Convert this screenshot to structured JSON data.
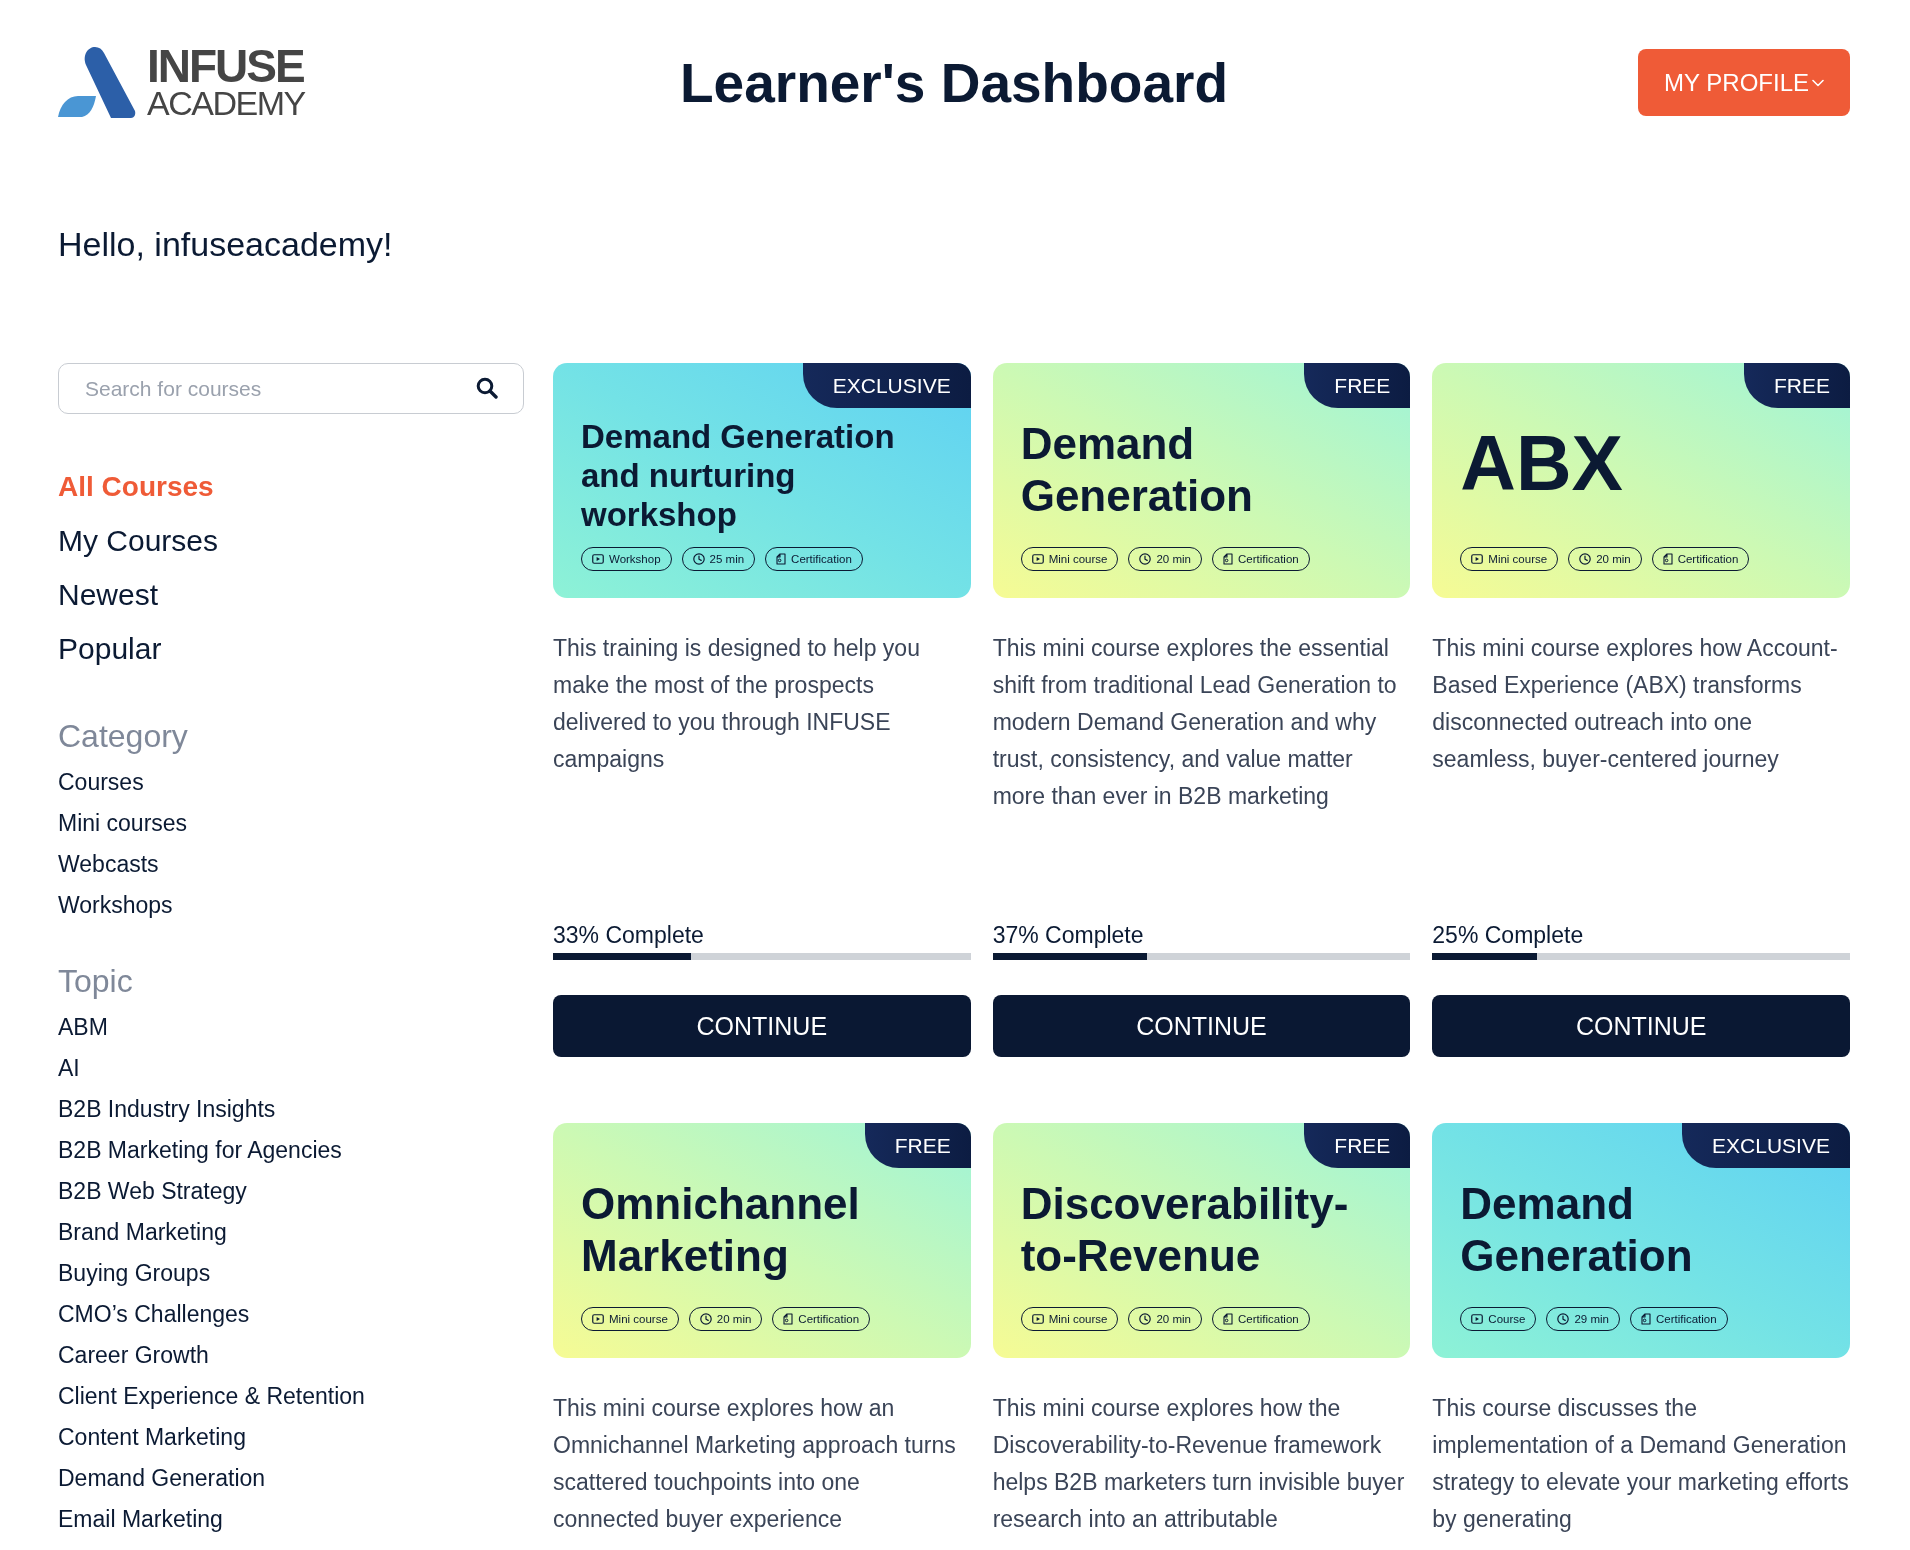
{
  "header": {
    "logo": {
      "name": "INFUSE",
      "subtitle": "ACADEMY"
    },
    "title": "Learner's Dashboard",
    "profile_button": {
      "label": "MY PROFILE"
    }
  },
  "greeting": "Hello, infuseacademy!",
  "sidebar": {
    "search": {
      "placeholder": "Search for courses"
    },
    "nav": [
      {
        "label": "All Courses",
        "selected": true
      },
      {
        "label": "My Courses",
        "selected": false
      },
      {
        "label": "Newest",
        "selected": false
      },
      {
        "label": "Popular",
        "selected": false
      }
    ],
    "sections": [
      {
        "title": "Category",
        "items": [
          "Courses",
          "Mini courses",
          "Webcasts",
          "Workshops"
        ]
      },
      {
        "title": "Topic",
        "items": [
          "ABM",
          "AI",
          "B2B Industry Insights",
          "B2B Marketing for Agencies",
          "B2B Web Strategy",
          "Brand Marketing",
          "Buying Groups",
          "CMO’s Challenges",
          "Career Growth",
          "Client Experience & Retention",
          "Content Marketing",
          "Demand Generation",
          "Email Marketing"
        ]
      }
    ]
  },
  "courses": [
    {
      "badge": {
        "label": "EXCLUSIVE",
        "kind": "exclusive"
      },
      "title": "Demand Generation and nurturing workshop",
      "tags": [
        {
          "kind": "format",
          "label": "Workshop"
        },
        {
          "kind": "duration",
          "label": "25 min"
        },
        {
          "kind": "certification",
          "label": "Certification"
        }
      ],
      "description": "This training is designed to help you make the most of the prospects delivered to you through INFUSE campaigns",
      "progress": {
        "label": "33% Complete",
        "level": 0.33
      },
      "button": "CONTINUE"
    },
    {
      "badge": {
        "label": "FREE",
        "kind": "free"
      },
      "title": "Demand Generation",
      "tags": [
        {
          "kind": "format",
          "label": "Mini course"
        },
        {
          "kind": "duration",
          "label": "20 min"
        },
        {
          "kind": "certification",
          "label": "Certification"
        }
      ],
      "description": "This mini course explores the essential shift from traditional Lead Generation to modern Demand Generation and why trust, consistency, and value matter more than ever in B2B marketing",
      "progress": {
        "label": "37% Complete",
        "level": 0.37
      },
      "button": "CONTINUE"
    },
    {
      "badge": {
        "label": "FREE",
        "kind": "free"
      },
      "title": "ABX",
      "tags": [
        {
          "kind": "format",
          "label": "Mini course"
        },
        {
          "kind": "duration",
          "label": "20 min"
        },
        {
          "kind": "certification",
          "label": "Certification"
        }
      ],
      "description": "This mini course explores how Account-Based Experience (ABX) transforms disconnected outreach into one seamless, buyer-centered journey",
      "progress": {
        "label": "25% Complete",
        "level": 0.25
      },
      "button": "CONTINUE"
    },
    {
      "badge": {
        "label": "FREE",
        "kind": "free"
      },
      "title": "Omnichannel Marketing",
      "tags": [
        {
          "kind": "format",
          "label": "Mini course"
        },
        {
          "kind": "duration",
          "label": "20 min"
        },
        {
          "kind": "certification",
          "label": "Certification"
        }
      ],
      "description": "This mini course explores how an Omnichannel Marketing approach turns scattered touchpoints into one connected buyer experience"
    },
    {
      "badge": {
        "label": "FREE",
        "kind": "free"
      },
      "title": "Discoverability-to-Revenue",
      "tags": [
        {
          "kind": "format",
          "label": "Mini course"
        },
        {
          "kind": "duration",
          "label": "20 min"
        },
        {
          "kind": "certification",
          "label": "Certification"
        }
      ],
      "description": "This mini course explores how the Discoverability-to-Revenue framework helps B2B marketers turn invisible buyer research into an attributable"
    },
    {
      "badge": {
        "label": "EXCLUSIVE",
        "kind": "exclusive"
      },
      "title": "Demand Generation",
      "tags": [
        {
          "kind": "format",
          "label": "Course"
        },
        {
          "kind": "duration",
          "label": "29 min"
        },
        {
          "kind": "certification",
          "label": "Certification"
        }
      ],
      "description": "This course discusses the implementation of a Demand Generation strategy to elevate your marketing efforts by generating"
    }
  ]
}
